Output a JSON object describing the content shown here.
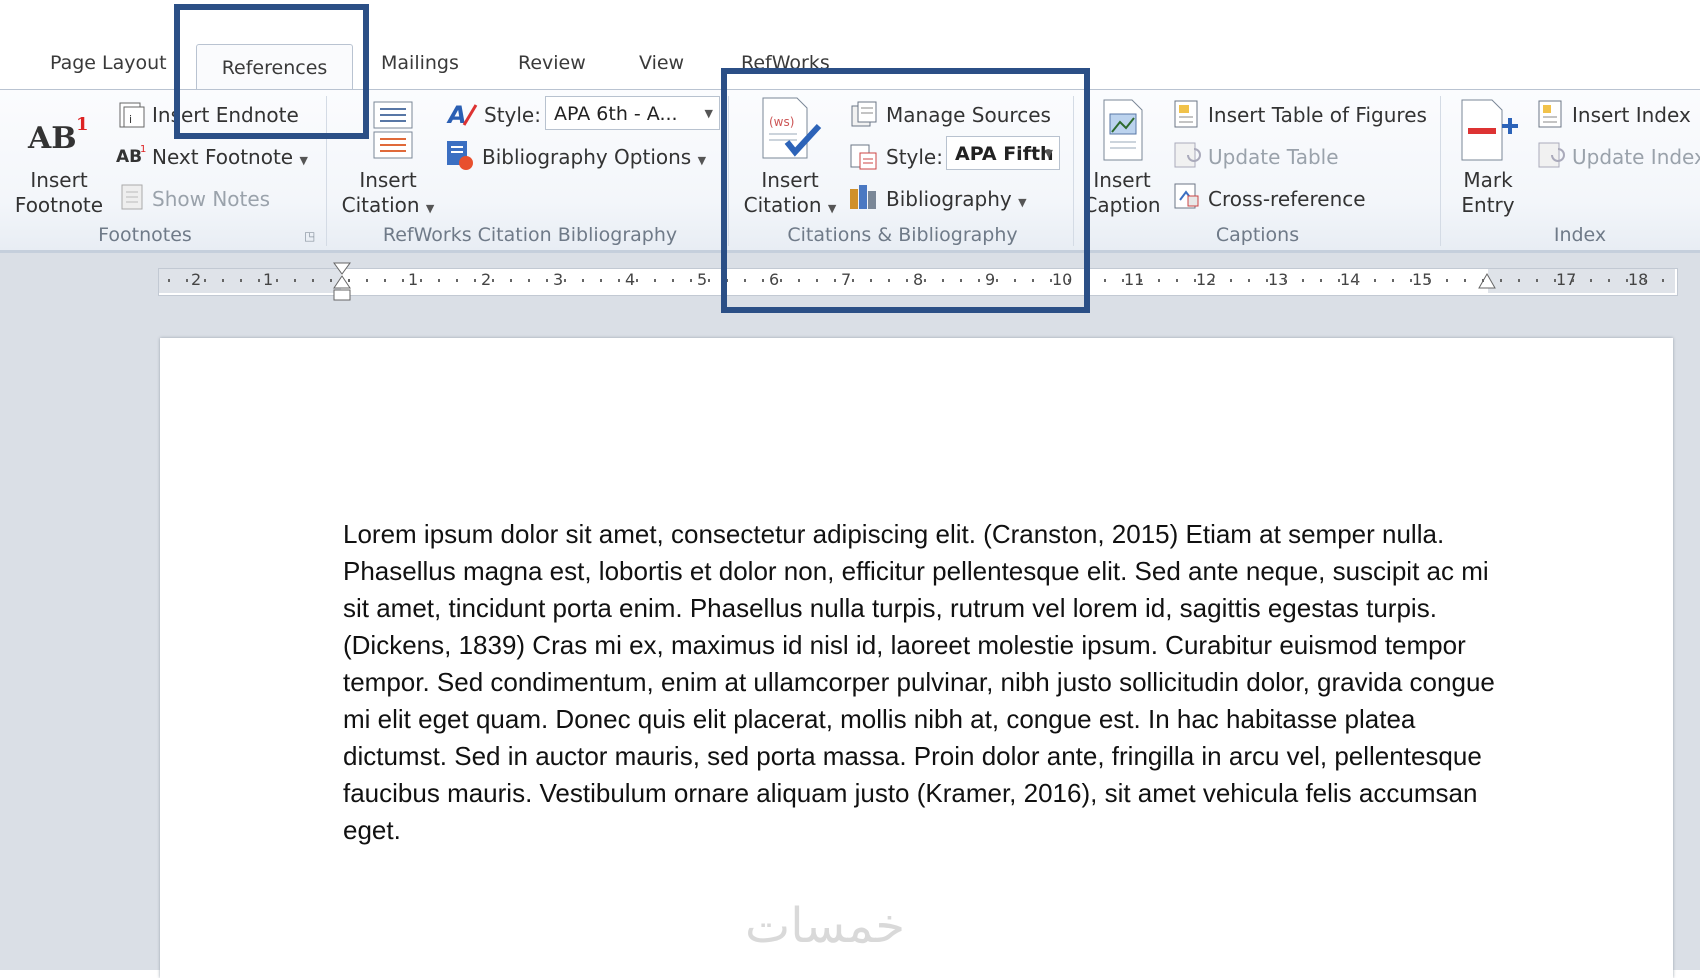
{
  "tabs": [
    "Page Layout",
    "References",
    "Mailings",
    "Review",
    "View",
    "RefWorks"
  ],
  "active_tab": "References",
  "ribbon": {
    "footnotes": {
      "insert_footnote": "Insert\nFootnote",
      "insert_endnote": "Insert Endnote",
      "next_footnote": "Next Footnote",
      "show_notes": "Show Notes",
      "group_label": "Footnotes"
    },
    "refworks": {
      "insert_citation_line1": "Insert",
      "insert_citation_line2": "Citation",
      "style_label": "Style:",
      "style_value": "APA 6th - A...",
      "bibliography_options": "Bibliography Options",
      "group_label": "RefWorks Citation  Bibliography"
    },
    "citations": {
      "insert_citation_line1": "Insert",
      "insert_citation_line2": "Citation",
      "manage_sources": "Manage Sources",
      "style_label": "Style:",
      "style_value": "APA Fifth",
      "bibliography": "Bibliography",
      "group_label": "Citations & Bibliography"
    },
    "captions": {
      "insert_caption_line1": "Insert",
      "insert_caption_line2": "Caption",
      "insert_table_of_figures": "Insert Table of Figures",
      "update_table": "Update Table",
      "cross_reference": "Cross-reference",
      "group_label": "Captions"
    },
    "index": {
      "mark_entry_line1": "Mark",
      "mark_entry_line2": "Entry",
      "insert_index": "Insert Index",
      "update_index": "Update Index",
      "group_label": "Index"
    }
  },
  "ruler": {
    "labels": [
      "2",
      "1",
      "1",
      "2",
      "3",
      "4",
      "5",
      "6",
      "7",
      "8",
      "9",
      "10",
      "11",
      "12",
      "13",
      "14",
      "15",
      "17",
      "18"
    ]
  },
  "document": {
    "paragraph": "Lorem ipsum dolor sit amet, consectetur adipiscing elit. (Cranston, 2015) Etiam at semper nulla. Phasellus magna est, lobortis et dolor non, efficitur pellentesque elit. Sed ante neque, suscipit ac mi sit amet, tincidunt porta enim. Phasellus nulla turpis, rutrum vel lorem id, sagittis egestas turpis. (Dickens, 1839) Cras mi ex, maximus id nisl id, laoreet molestie ipsum. Curabitur euismod tempor tempor. Sed condimentum, enim at ullamcorper pulvinar, nibh justo sollicitudin dolor, gravida congue mi elit eget quam. Donec quis elit placerat, mollis nibh at, congue est. In hac habitasse platea dictumst. Sed in auctor mauris, sed porta massa. Proin dolor ante, fringilla in arcu vel, pellentesque faucibus mauris. Vestibulum ornare aliquam justo (Kramer, 2016), sit amet vehicula felis accumsan eget."
  },
  "watermark": "خمسات",
  "colors": {
    "highlight": "#2b4f86",
    "ribbon_bg": "#f3f6fa",
    "doc_bg": "#dadfe6",
    "group_label": "#6f7a88"
  }
}
